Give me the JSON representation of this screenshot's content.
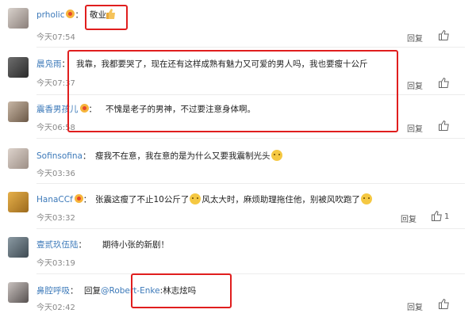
{
  "comments": [
    {
      "user": "prholic",
      "vip": true,
      "text": "敬业",
      "time": "今天07:54",
      "reply": "回复",
      "likes": ""
    },
    {
      "user": "晨凫雨",
      "vip": false,
      "text": "我靠，我都要哭了，现在还有这样成熟有魅力又可爱的男人吗，我也要瘦十公斤",
      "time": "今天07:37",
      "reply": "回复",
      "likes": ""
    },
    {
      "user": "震香男孩儿",
      "vip": true,
      "text": "不愧是老子的男神，不过要注意身体啊。",
      "time": "今天06:58",
      "reply": "回复",
      "likes": ""
    },
    {
      "user": "Sofinsofina",
      "vip": false,
      "text": "瘦我不在意，我在意的是为什么又要我震制光头",
      "time": "今天03:36",
      "reply": "回复",
      "likes": ""
    },
    {
      "user": "HanaCCf",
      "vip": true,
      "text": "张震这瘦了不止10公斤了",
      "text2": "风太大时，麻烦助理拖住他，别被风吹跑了",
      "time": "今天03:32",
      "reply": "回复",
      "likes": "1"
    },
    {
      "user": "壹贰玖伍陆",
      "vip": false,
      "text": "期待小张的新剧！",
      "time": "今天03:19",
      "reply": "回复",
      "likes": ""
    },
    {
      "user": "鼻腔呼吸",
      "vip": false,
      "reply_prefix": "回复",
      "mention": "@Robert-Enke",
      "text": ":林志炫吗",
      "time": "今天02:42",
      "reply": "回复",
      "likes": ""
    }
  ],
  "colors": {
    "link": "#3c79b9",
    "highlight": "#e01e1e",
    "vip": "#f6b53b"
  }
}
